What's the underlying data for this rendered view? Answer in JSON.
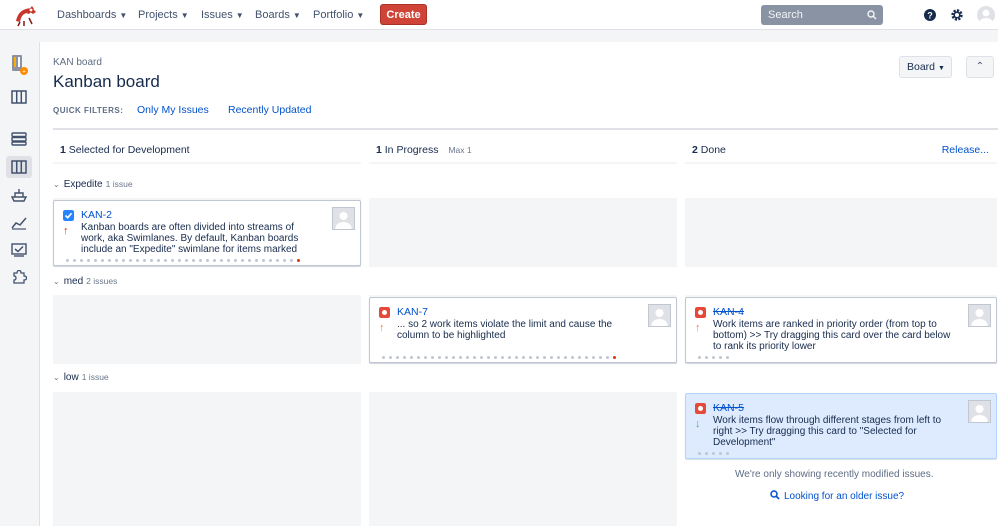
{
  "topnav": {
    "items": [
      {
        "label": "Dashboards"
      },
      {
        "label": "Projects"
      },
      {
        "label": "Issues"
      },
      {
        "label": "Boards"
      },
      {
        "label": "Portfolio"
      }
    ],
    "create_label": "Create",
    "search_placeholder": "Search"
  },
  "page": {
    "breadcrumb": "KAN board",
    "title": "Kanban board",
    "quick_filters_label": "QUICK FILTERS:",
    "quick_filters": [
      "Only My Issues",
      "Recently Updated"
    ],
    "board_button": "Board"
  },
  "columns": [
    {
      "count": "1",
      "name": "Selected for Development"
    },
    {
      "count": "1",
      "name": "In Progress",
      "max": "Max 1"
    },
    {
      "count": "2",
      "name": "Done",
      "action": "Release..."
    }
  ],
  "lanes": [
    {
      "name": "Expedite",
      "count": "1 issue"
    },
    {
      "name": "med",
      "count": "2 issues"
    },
    {
      "name": "low",
      "count": "1 issue"
    }
  ],
  "cards": {
    "kan2": {
      "key": "KAN-2",
      "summary": "Kanban boards are often divided into streams of work, aka Swimlanes. By default, Kanban boards include an \"Expedite\" swimlane for items marked"
    },
    "kan7": {
      "key": "KAN-7",
      "summary": "... so 2 work items violate the limit and cause the column to be highlighted"
    },
    "kan4": {
      "key": "KAN-4",
      "summary": "Work items are ranked in priority order (from top to bottom) >> Try dragging this card over the card below to rank its priority lower"
    },
    "kan5": {
      "key": "KAN-5",
      "summary": "Work items flow through different stages from left to right >> Try dragging this card to \"Selected for Development\""
    }
  },
  "footer": {
    "note": "We're only showing recently modified issues.",
    "older_link": "Looking for an older issue?"
  },
  "colors": {
    "create": "#d04437",
    "link": "#0052cc",
    "selected_card": "#deebff",
    "bug": "#e5493a",
    "story": "#2684ff"
  }
}
